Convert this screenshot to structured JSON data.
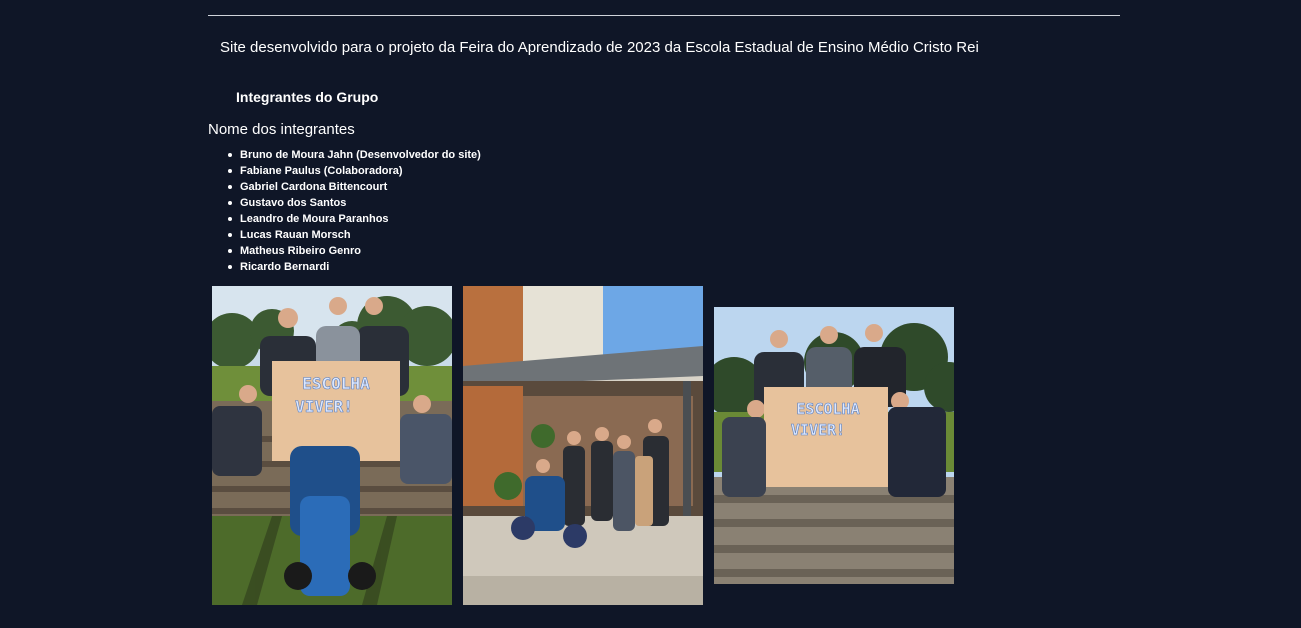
{
  "header": {
    "intro": "Site desenvolvido para o projeto da Feira do Aprendizado de 2023 da Escola Estadual de Ensino Médio Cristo Rei"
  },
  "group": {
    "title": "Integrantes do Grupo",
    "names_heading": "Nome dos integrantes",
    "members": [
      "Bruno de Moura Jahn (Desenvolvedor do site)",
      "Fabiane Paulus (Colaboradora)",
      "Gabriel Cardona Bittencourt",
      "Gustavo dos Santos",
      "Leandro de Moura Paranhos",
      "Lucas Rauan Morsch",
      "Matheus Ribeiro Genro",
      "Ricardo Bernardi"
    ]
  },
  "photos": {
    "banner_line1": "ESCOLHA",
    "banner_line2": "VIVER!",
    "items": [
      {
        "name": "group-photo-banner-outdoor"
      },
      {
        "name": "group-photo-covered-porch"
      },
      {
        "name": "group-photo-banner-stairs"
      }
    ]
  },
  "colors": {
    "background": "#0f1627",
    "text": "#ffffff",
    "rule": "#cfd3da",
    "banner": "#e7c29c"
  }
}
